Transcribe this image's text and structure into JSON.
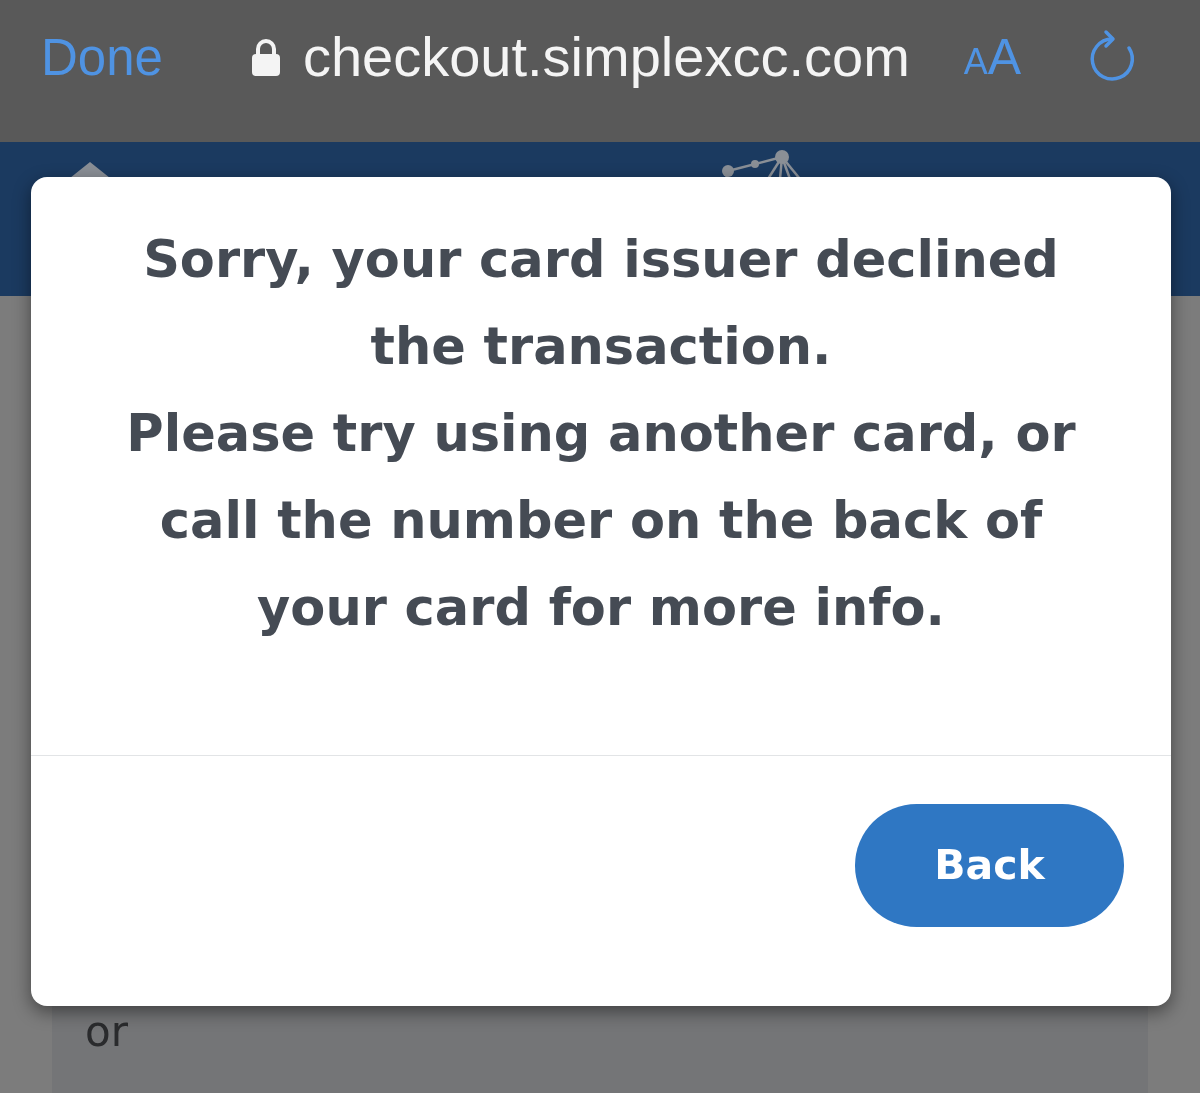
{
  "browser_bar": {
    "done_label": "Done",
    "url": "checkout.simplexcc.com",
    "text_size_button": [
      "A",
      "A"
    ]
  },
  "page": {
    "text": "or"
  },
  "dialog": {
    "message": [
      "Sorry, your card issuer declined the transaction.",
      "Please try using another card, or call the number on the back of your card for more info."
    ],
    "button": "Back"
  }
}
